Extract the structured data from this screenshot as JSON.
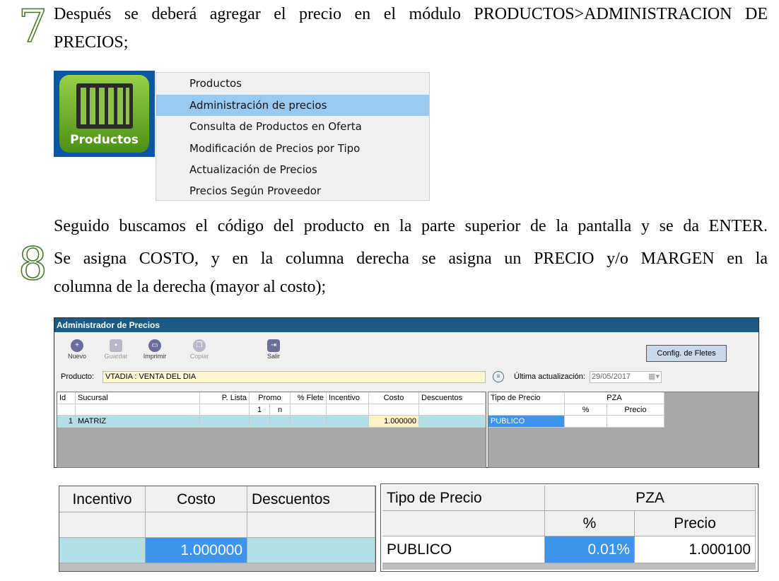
{
  "step7": {
    "number": "7",
    "line1": "Después se deberá agregar el precio en el módulo PRODUCTOS>ADMINISTRACION DE",
    "line2": "PRECIOS;"
  },
  "module_icon": {
    "label": "Productos"
  },
  "menu": {
    "items": [
      {
        "label": "Productos",
        "highlighted": false
      },
      {
        "label": "Administración de precios",
        "highlighted": true
      },
      {
        "label": "Consulta de Productos en Oferta",
        "highlighted": false
      },
      {
        "label": "Modificación de Precios por Tipo",
        "highlighted": false
      },
      {
        "label": "Actualización de Precios",
        "highlighted": false
      },
      {
        "label": "Precios Según Proveedor",
        "highlighted": false
      }
    ]
  },
  "step8": {
    "number": "8",
    "line0": "Seguido buscamos el código del producto en la parte superior de la pantalla y se da ENTER.",
    "line1": "Se asigna COSTO, y en la columna derecha se asigna un PRECIO y/o MARGEN en la",
    "line2": "columna de la derecha (mayor al costo);"
  },
  "window": {
    "title": "Administrador de Precios",
    "toolbar": {
      "nuevo": "Nuevo",
      "guardar": "Guardar",
      "imprimir": "Imprimir",
      "copiar": "Copiar",
      "salir": "Salir",
      "config_fletes": "Config. de Fletes"
    },
    "producto_label": "Producto:",
    "producto_value": "VTADIA : VENTA DEL DIA",
    "ultima_label": "Última actualización:",
    "ultima_value": "29/05/2017",
    "left_grid": {
      "headers": [
        "Id",
        "Sucursal",
        "P. Lista",
        "Promo",
        "% Flete",
        "Incentivo",
        "Costo",
        "Descuentos"
      ],
      "promo_sub": [
        "1",
        "n"
      ],
      "row": {
        "id": "1",
        "sucursal": "MATRIZ",
        "costo": "1.000000"
      }
    },
    "right_grid": {
      "headers": {
        "tipo": "Tipo de Precio",
        "pza": "PZA",
        "pct": "%",
        "precio": "Precio"
      },
      "row": {
        "tipo": "PUBLICO"
      }
    }
  },
  "zoom_left": {
    "headers": [
      "Incentivo",
      "Costo",
      "Descuentos"
    ],
    "row": {
      "costo": "1.000000"
    }
  },
  "zoom_right": {
    "headers": {
      "tipo": "Tipo de Precio",
      "pza": "PZA",
      "pct": "%",
      "precio": "Precio"
    },
    "row": {
      "tipo": "PUBLICO",
      "pct": "0.01%",
      "precio": "1.000100"
    }
  },
  "colors": {
    "highlight_blue": "#98c9f0",
    "selected_cell": "#3d94ea",
    "row_cyan": "#b3e0e6",
    "title_bar": "#1a5b86",
    "step_number_outline": "#4a7a2a"
  }
}
